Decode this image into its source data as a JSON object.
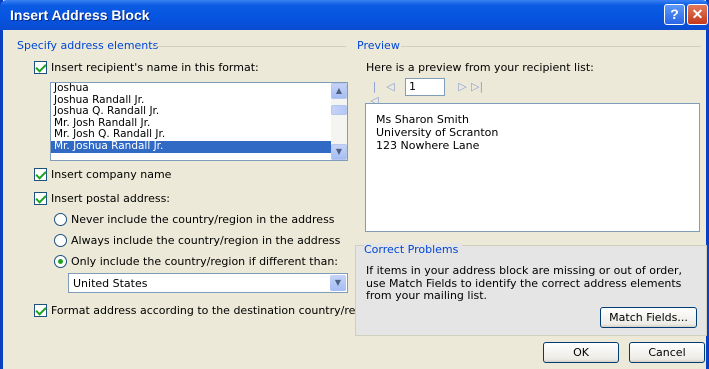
{
  "window": {
    "title": "Insert Address Block",
    "help_label": "?",
    "close_label": "✕"
  },
  "specify": {
    "group_label": "Specify address elements",
    "insert_name_label": "Insert recipient's name in this format:",
    "insert_name_checked": true,
    "name_formats": [
      "Joshua",
      "Joshua Randall Jr.",
      "Joshua Q. Randall Jr.",
      "Mr. Josh Randall Jr.",
      "Mr. Josh Q. Randall Jr.",
      "Mr. Joshua Randall Jr."
    ],
    "selected_format": "Mr. Joshua Randall Jr.",
    "insert_company_label": "Insert company name",
    "insert_company_checked": true,
    "insert_postal_label": "Insert postal address:",
    "insert_postal_checked": true,
    "radio_never": "Never include the country/region in the address",
    "radio_always": "Always include the country/region in the address",
    "radio_only": "Only include the country/region if different than:",
    "selected_radio": "only",
    "country_value": "United States",
    "format_address_label": "Format address according to the destination country/region",
    "format_address_checked": true
  },
  "preview": {
    "group_label": "Preview",
    "intro_text": "Here is a preview from your recipient list:",
    "record_number": "1",
    "address_lines": [
      "Ms Sharon Smith",
      "University of Scranton",
      "123 Nowhere Lane"
    ]
  },
  "correct_problems": {
    "group_label": "Correct Problems",
    "text": "If items in your address block are missing or out of order, use Match Fields to identify the correct address elements from your mailing list.",
    "match_fields_label": "Match Fields..."
  },
  "buttons": {
    "ok_label": "OK",
    "cancel_label": "Cancel"
  },
  "colors": {
    "title_bar": "#0a5be3",
    "group_label": "#0046d5",
    "selection": "#316ac5",
    "check_mark": "#21a121"
  }
}
